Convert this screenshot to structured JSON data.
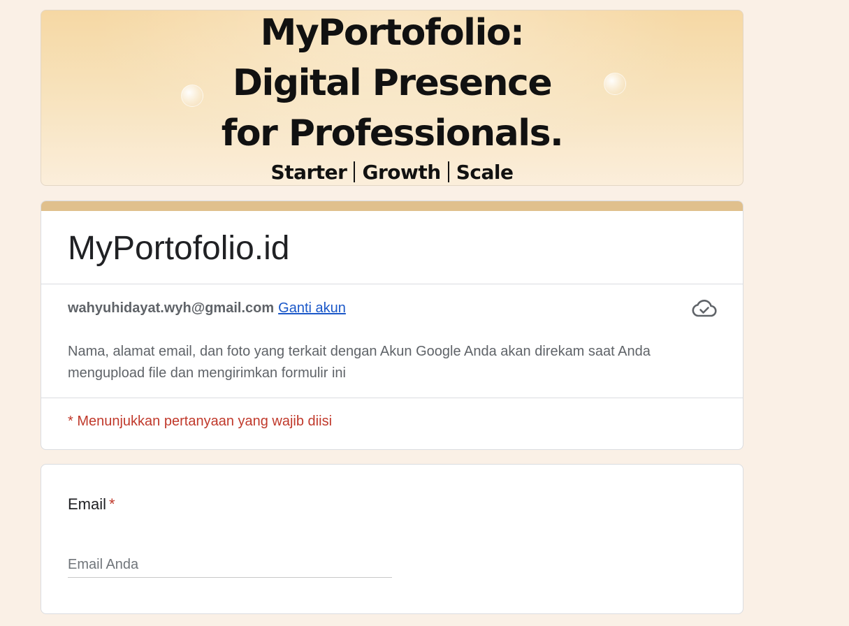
{
  "banner": {
    "title_lines": [
      "MyPortofolio:",
      "Digital Presence",
      "for Professionals."
    ],
    "tiers": [
      "Starter",
      "Growth",
      "Scale"
    ]
  },
  "header": {
    "title": "MyPortofolio.id",
    "account_email": "wahyuhidayat.wyh@gmail.com",
    "switch_account_label": "Ganti akun",
    "notice": "Nama, alamat email, dan foto yang terkait dengan Akun Google Anda akan direkam saat Anda mengupload file dan mengirimkan formulir ini",
    "required_note": "* Menunjukkan pertanyaan yang wajib diisi",
    "save_status_icon": "cloud-check-icon"
  },
  "questions": [
    {
      "title": "Email",
      "required_marker": "*",
      "placeholder": "Email Anda",
      "value": ""
    }
  ],
  "colors": {
    "page_background": "#faf0e6",
    "accent": "#e0c08d",
    "link": "#1a57c8",
    "required": "#c0392b"
  }
}
